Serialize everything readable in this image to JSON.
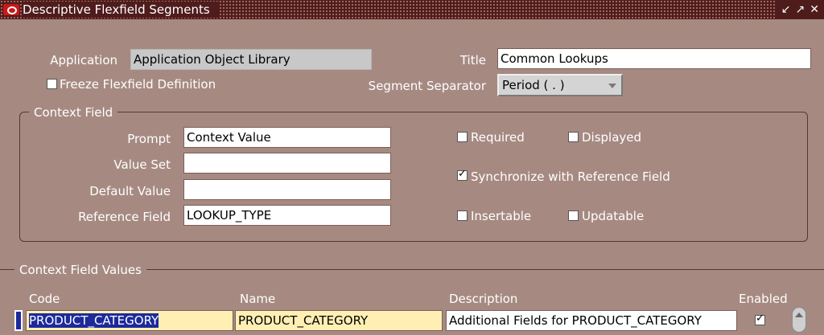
{
  "window": {
    "title": "Descriptive Flexfield Segments",
    "controls": [
      "↙",
      "↗",
      "✕"
    ]
  },
  "header": {
    "application_label": "Application",
    "application_value": "Application Object Library",
    "title_label": "Title",
    "title_value": "Common Lookups",
    "freeze_label": "Freeze Flexfield Definition",
    "freeze_checked": false,
    "separator_label": "Segment Separator",
    "separator_value": "Period ( . )"
  },
  "context_field": {
    "group_title": "Context Field",
    "prompt_label": "Prompt",
    "prompt_value": "Context Value",
    "value_set_label": "Value Set",
    "value_set_value": "",
    "default_value_label": "Default Value",
    "default_value_value": "",
    "reference_field_label": "Reference Field",
    "reference_field_value": "LOOKUP_TYPE",
    "required_label": "Required",
    "required_checked": false,
    "displayed_label": "Displayed",
    "displayed_checked": false,
    "synchronize_label": "Synchronize with Reference Field",
    "synchronize_checked": true,
    "insertable_label": "Insertable",
    "insertable_checked": false,
    "updatable_label": "Updatable",
    "updatable_checked": false
  },
  "context_values": {
    "section_title": "Context Field Values",
    "columns": {
      "code": "Code",
      "name": "Name",
      "description": "Description",
      "enabled": "Enabled"
    },
    "rows": [
      {
        "code": "PRODUCT_CATEGORY",
        "name": "PRODUCT_CATEGORY",
        "description": "Additional Fields for PRODUCT_CATEGORY",
        "enabled": true
      }
    ]
  }
}
